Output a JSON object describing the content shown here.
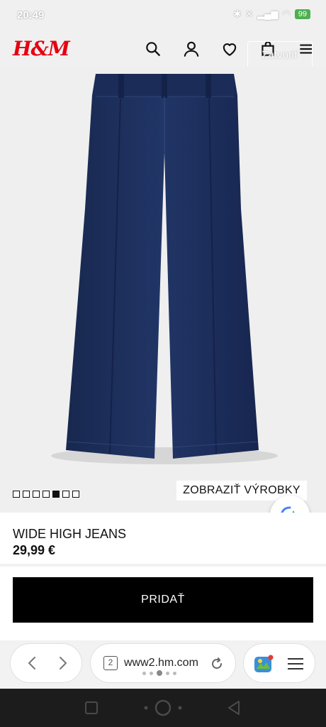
{
  "status": {
    "time": "20:49",
    "battery": "99"
  },
  "header": {
    "logo": "H&M",
    "close_label": "Zatvoriť"
  },
  "gallery": {
    "dot_count": 7,
    "active_index": 4,
    "show_products_label": "ZOBRAZIŤ VÝROBKY"
  },
  "product": {
    "name": "WIDE HIGH JEANS",
    "price": "29,99 €"
  },
  "actions": {
    "add_label": "PRIDAŤ"
  },
  "browser": {
    "tab_count": "2",
    "url": "www2.hm.com"
  },
  "colors": {
    "brand": "#e50010",
    "denim": "#1d2f5e"
  },
  "icons": [
    "search-icon",
    "account-icon",
    "heart-icon",
    "bag-icon",
    "menu-icon",
    "back-icon",
    "forward-icon",
    "refresh-icon",
    "lens-icon",
    "game-icon",
    "browser-menu-icon",
    "home-square-icon",
    "home-circle-icon",
    "back-triangle-icon"
  ]
}
